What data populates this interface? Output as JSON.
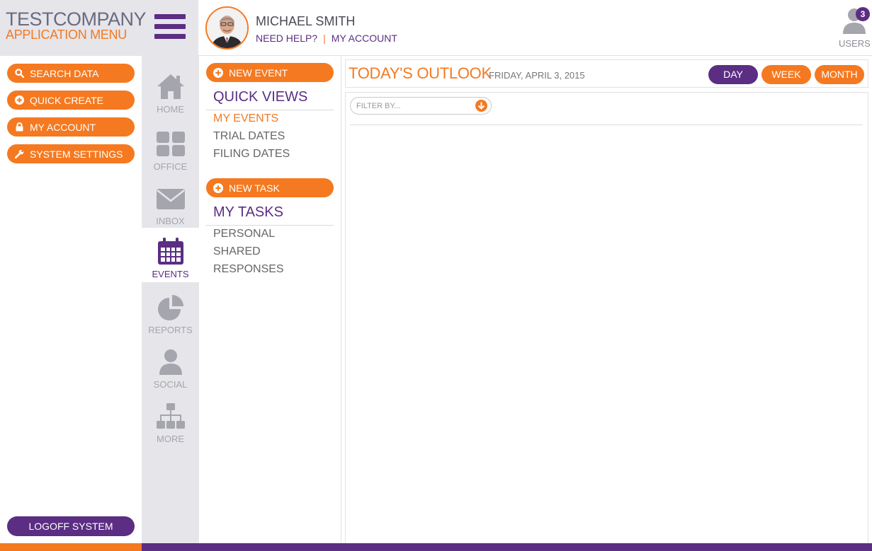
{
  "brand": {
    "title_part1": "TEST",
    "title_part2": "COMPANY",
    "subtitle": "APPLICATION MENU"
  },
  "header": {
    "user_name": "MICHAEL SMITH",
    "need_help": "NEED HELP?",
    "separator": "|",
    "my_account": "MY ACCOUNT",
    "users_label": "USERS",
    "users_count": "3"
  },
  "left_menu": {
    "items": [
      {
        "label": "SEARCH DATA",
        "icon": "search-icon"
      },
      {
        "label": "QUICK CREATE",
        "icon": "plus-circle-icon"
      },
      {
        "label": "MY ACCOUNT",
        "icon": "lock-icon"
      },
      {
        "label": "SYSTEM SETTINGS",
        "icon": "wrench-icon"
      }
    ],
    "logoff": "LOGOFF SYSTEM"
  },
  "icon_nav": {
    "items": [
      {
        "label": "HOME",
        "icon": "home-icon"
      },
      {
        "label": "OFFICE",
        "icon": "office-grid-icon"
      },
      {
        "label": "INBOX",
        "icon": "envelope-icon"
      },
      {
        "label": "EVENTS",
        "icon": "calendar-icon",
        "active": true
      },
      {
        "label": "REPORTS",
        "icon": "pie-chart-icon"
      },
      {
        "label": "SOCIAL",
        "icon": "person-icon"
      },
      {
        "label": "MORE",
        "icon": "sitemap-icon"
      }
    ]
  },
  "events_panel": {
    "new_event": "NEW EVENT",
    "quick_views_title": "QUICK VIEWS",
    "quick_views": [
      "MY EVENTS",
      "TRIAL DATES",
      "FILING DATES"
    ],
    "new_task": "NEW TASK",
    "my_tasks_title": "MY TASKS",
    "my_tasks": [
      "PERSONAL",
      "SHARED",
      "RESPONSES"
    ]
  },
  "outlook": {
    "title": "TODAY'S OUTLOOK",
    "date": "FRIDAY, APRIL 3, 2015",
    "views": [
      "DAY",
      "WEEK",
      "MONTH"
    ],
    "active_view": "DAY",
    "filter_placeholder": "FILTER BY..."
  },
  "colors": {
    "orange": "#f57920",
    "purple": "#5b2d83",
    "nav_gray": "#e5e5ea",
    "icon_gray": "#a5a5ad"
  }
}
